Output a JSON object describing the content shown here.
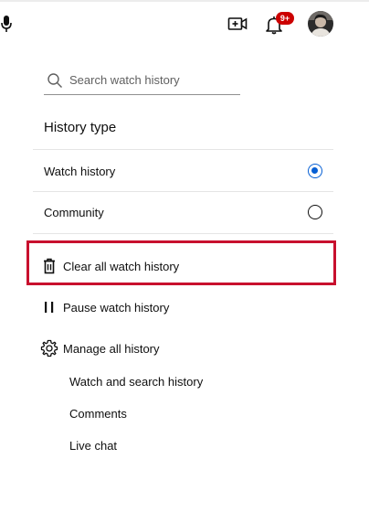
{
  "topbar": {
    "mic_icon": "mic-icon",
    "create_icon": "video-plus-icon",
    "notifications_icon": "bell-icon",
    "notification_badge": "9+",
    "avatar_icon": "user-avatar"
  },
  "search": {
    "placeholder": "Search watch history",
    "value": ""
  },
  "history_type": {
    "title": "History type",
    "options": [
      {
        "label": "Watch history",
        "selected": true
      },
      {
        "label": "Community",
        "selected": false
      }
    ]
  },
  "actions": {
    "clear_all": "Clear all watch history",
    "pause": "Pause watch history",
    "manage": "Manage all history"
  },
  "manage_links": {
    "watch_search": "Watch and search history",
    "comments": "Comments",
    "live_chat": "Live chat"
  },
  "colors": {
    "accent": "#065fd4",
    "badge": "#cc0000",
    "highlight": "#c8102e"
  }
}
